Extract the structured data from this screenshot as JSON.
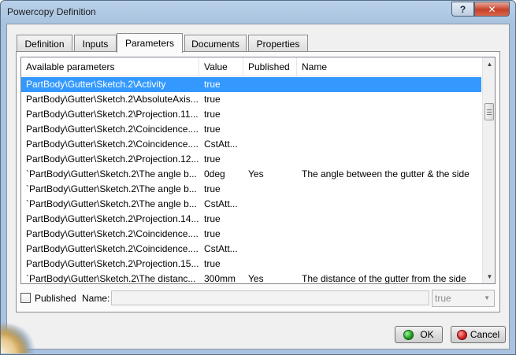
{
  "window": {
    "title": "Powercopy Definition"
  },
  "titlebar_buttons": {
    "help": "?",
    "close": "✕"
  },
  "tabs": [
    {
      "label": "Definition",
      "active": false
    },
    {
      "label": "Inputs",
      "active": false
    },
    {
      "label": "Parameters",
      "active": true
    },
    {
      "label": "Documents",
      "active": false
    },
    {
      "label": "Properties",
      "active": false
    }
  ],
  "table": {
    "columns": [
      "Available parameters",
      "Value",
      "Published",
      "Name"
    ],
    "rows": [
      {
        "param": "PartBody\\Gutter\\Sketch.2\\Activity",
        "value": "true",
        "published": "",
        "name": ""
      },
      {
        "param": "PartBody\\Gutter\\Sketch.2\\AbsoluteAxis...",
        "value": "true",
        "published": "",
        "name": ""
      },
      {
        "param": "PartBody\\Gutter\\Sketch.2\\Projection.11...",
        "value": "true",
        "published": "",
        "name": ""
      },
      {
        "param": "PartBody\\Gutter\\Sketch.2\\Coincidence....",
        "value": "true",
        "published": "",
        "name": ""
      },
      {
        "param": "PartBody\\Gutter\\Sketch.2\\Coincidence....",
        "value": "CstAtt...",
        "published": "",
        "name": ""
      },
      {
        "param": "PartBody\\Gutter\\Sketch.2\\Projection.12...",
        "value": "true",
        "published": "",
        "name": ""
      },
      {
        "param": "`PartBody\\Gutter\\Sketch.2\\The angle b...",
        "value": "0deg",
        "published": "Yes",
        "name": "The angle between the gutter & the side"
      },
      {
        "param": "`PartBody\\Gutter\\Sketch.2\\The angle b...",
        "value": "true",
        "published": "",
        "name": ""
      },
      {
        "param": "`PartBody\\Gutter\\Sketch.2\\The angle b...",
        "value": "CstAtt...",
        "published": "",
        "name": ""
      },
      {
        "param": "PartBody\\Gutter\\Sketch.2\\Projection.14...",
        "value": "true",
        "published": "",
        "name": ""
      },
      {
        "param": "PartBody\\Gutter\\Sketch.2\\Coincidence....",
        "value": "true",
        "published": "",
        "name": ""
      },
      {
        "param": "PartBody\\Gutter\\Sketch.2\\Coincidence....",
        "value": "CstAtt...",
        "published": "",
        "name": ""
      },
      {
        "param": "PartBody\\Gutter\\Sketch.2\\Projection.15...",
        "value": "true",
        "published": "",
        "name": ""
      },
      {
        "param": "`PartBody\\Gutter\\Sketch.2\\The distanc...",
        "value": "300mm",
        "published": "Yes",
        "name": "The distance of the gutter from the side"
      }
    ],
    "selected_index": 0
  },
  "publish": {
    "published_label": "Published",
    "published_checked": false,
    "name_label": "Name:",
    "name_value": "",
    "value_select": "true"
  },
  "buttons": {
    "ok": "OK",
    "cancel": "Cancel"
  },
  "colors": {
    "selection": "#3399ff",
    "titlebar": "#b9d1ea",
    "close": "#c7402a"
  }
}
